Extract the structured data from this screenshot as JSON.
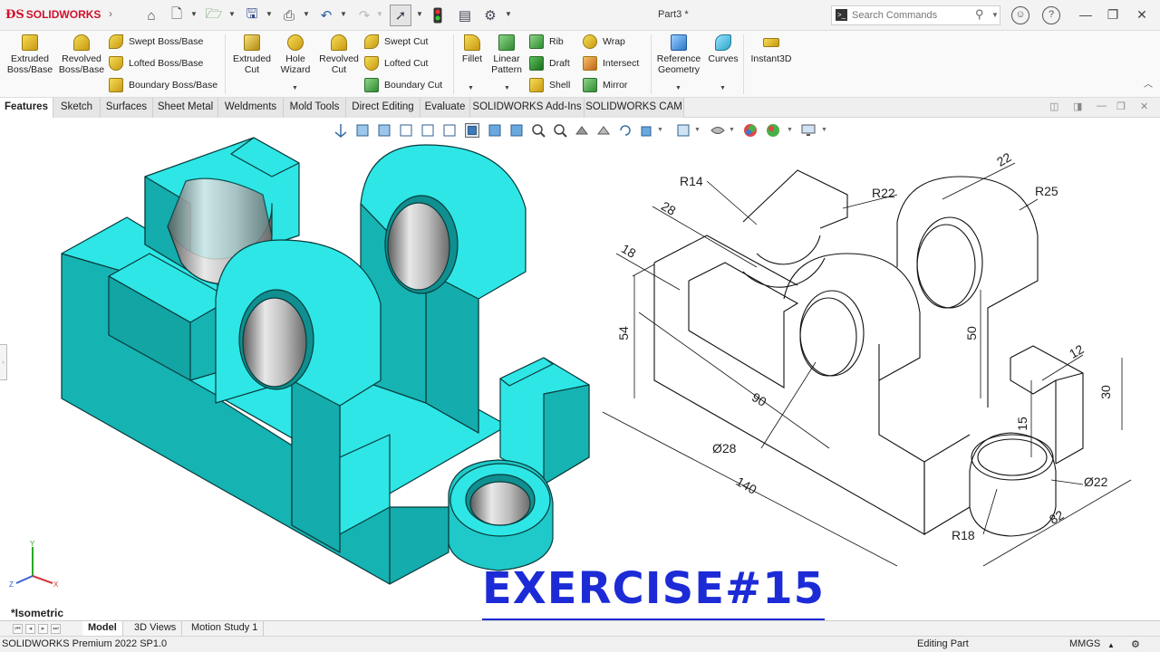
{
  "app": {
    "brand": "SOLIDWORKS",
    "document_title": "Part3 *"
  },
  "search": {
    "placeholder": "Search Commands"
  },
  "ribbon": {
    "extruded_boss": "Extruded Boss/Base",
    "revolved_boss": "Revolved Boss/Base",
    "swept_boss": "Swept Boss/Base",
    "lofted_boss": "Lofted Boss/Base",
    "boundary_boss": "Boundary Boss/Base",
    "extruded_cut": "Extruded Cut",
    "hole_wizard": "Hole Wizard",
    "revolved_cut": "Revolved Cut",
    "swept_cut": "Swept Cut",
    "lofted_cut": "Lofted Cut",
    "boundary_cut": "Boundary Cut",
    "fillet": "Fillet",
    "linear_pattern": "Linear Pattern",
    "rib": "Rib",
    "draft": "Draft",
    "shell": "Shell",
    "wrap": "Wrap",
    "intersect": "Intersect",
    "mirror": "Mirror",
    "reference_geometry": "Reference Geometry",
    "curves": "Curves",
    "instant3d": "Instant3D"
  },
  "tabs": [
    "Features",
    "Sketch",
    "Surfaces",
    "Sheet Metal",
    "Weldments",
    "Mold Tools",
    "Direct Editing",
    "Evaluate",
    "SOLIDWORKS Add-Ins",
    "SOLIDWORKS CAM"
  ],
  "drawing": {
    "dims": {
      "r14": "R14",
      "r22": "R22",
      "r25": "R25",
      "d22_top": "22",
      "d28": "28",
      "d18": "18",
      "d54": "54",
      "d50": "50",
      "d12": "12",
      "d30": "30",
      "d90": "90",
      "d15": "15",
      "dia28": "Ø28",
      "dia22": "Ø22",
      "d140": "140",
      "r18": "R18",
      "d82": "82"
    }
  },
  "graphics": {
    "view_label": "*Isometric",
    "exercise_title": "EXERCISE#15",
    "triad": {
      "y": "Y",
      "x": "X",
      "z": "Z"
    },
    "model_color": "#2ee6e6"
  },
  "bottom_tabs": [
    "Model",
    "3D Views",
    "Motion Study 1"
  ],
  "status": {
    "product": "SOLIDWORKS Premium 2022 SP1.0",
    "mode": "Editing Part",
    "units": "MMGS"
  }
}
